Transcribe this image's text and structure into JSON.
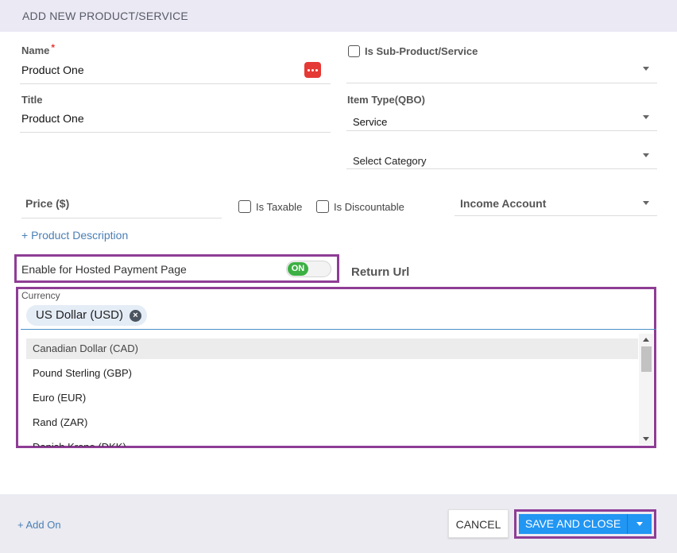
{
  "header": {
    "title": "ADD NEW PRODUCT/SERVICE"
  },
  "form": {
    "name": {
      "label": "Name",
      "required_mark": "*",
      "value": "Product One"
    },
    "title": {
      "label": "Title",
      "value": "Product One"
    },
    "sub_product": {
      "label": "Is Sub-Product/Service",
      "checked": false,
      "value": ""
    },
    "item_type": {
      "label": "Item Type(QBO)",
      "value": "Service"
    },
    "category": {
      "placeholder": "Select Category"
    },
    "price": {
      "label": "Price ($)"
    },
    "is_taxable": {
      "label": "Is Taxable",
      "checked": false
    },
    "is_discountable": {
      "label": "Is Discountable",
      "checked": false
    },
    "income_account": {
      "label": "Income Account"
    },
    "product_description_link": "+ Product Description",
    "hosted_payment": {
      "label": "Enable for Hosted Payment Page",
      "toggle_label": "ON",
      "enabled": true
    },
    "return_url": {
      "label": "Return Url"
    },
    "currency": {
      "label": "Currency",
      "selected": [
        "US Dollar (USD)"
      ],
      "options": [
        "Canadian Dollar (CAD)",
        "Pound Sterling (GBP)",
        "Euro (EUR)",
        "Rand (ZAR)",
        "Danish Krone (DKK)"
      ],
      "highlighted_option": "Canadian Dollar (CAD)"
    }
  },
  "footer": {
    "add_on_link": "+ Add On",
    "cancel_label": "CANCEL",
    "save_label": "SAVE AND CLOSE"
  },
  "colors": {
    "header_bg": "#ebe9f4",
    "highlight_border": "#8e3d95",
    "primary_button": "#2196f3",
    "toggle_on": "#3cb043",
    "link": "#4a7fb5",
    "required": "#e53935"
  },
  "icons": {
    "name_field": "more-dots-icon",
    "dropdown": "chevron-down-icon",
    "chip_remove": "close-circle-icon",
    "split_button": "caret-down-icon"
  }
}
